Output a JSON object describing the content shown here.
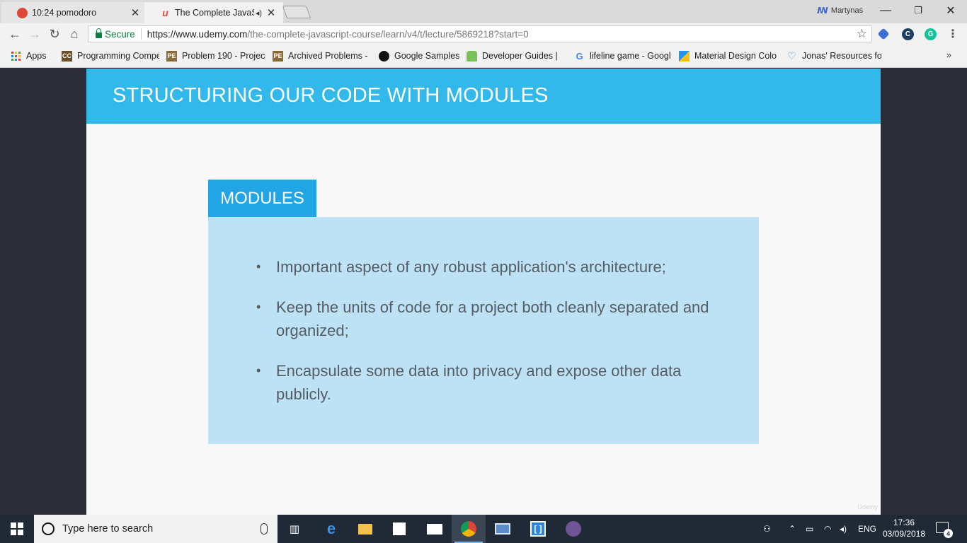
{
  "browser": {
    "tabs": [
      {
        "title": "10:24 pomodoro",
        "close": "✕"
      },
      {
        "title": "The Complete JavaScr",
        "audio": "◂)",
        "close": "✕"
      }
    ],
    "profile_name": "Martynas",
    "window_controls": {
      "minimize": "—",
      "maximize": "❐",
      "close": "✕"
    },
    "secure_label": "Secure",
    "url_host": "https://www.udemy.com",
    "url_path": "/the-complete-javascript-course/learn/v4/t/lecture/5869218?start=0",
    "bookmarks": [
      {
        "label": "Apps",
        "icon": "apps-grid"
      },
      {
        "label": "Programming Compe",
        "icon": "cc-icon",
        "icon_text": "CC",
        "color": "#6b4f2b"
      },
      {
        "label": "Problem 190 - Projec",
        "icon": "project-euler-icon",
        "icon_text": "PE",
        "color": "#8a6a3a"
      },
      {
        "label": "Archived Problems -",
        "icon": "project-euler-icon",
        "icon_text": "PE",
        "color": "#8a6a3a"
      },
      {
        "label": "Google Samples",
        "icon": "github-icon",
        "icon_text": "●",
        "color": "#111111"
      },
      {
        "label": "Developer Guides |",
        "icon": "android-icon",
        "icon_text": "▲",
        "color": "#78c257"
      },
      {
        "label": "lifeline game - Googl",
        "icon": "google-icon",
        "icon_text": "G",
        "color": "#4285f4"
      },
      {
        "label": "Material Design Colo",
        "icon": "material-icon",
        "icon_text": "",
        "color": "#2196f3"
      },
      {
        "label": "Jonas' Resources for",
        "icon": "heart-icon",
        "icon_text": "♡",
        "color": "#3a8fd8"
      }
    ],
    "overflow": "»"
  },
  "slide": {
    "title": "STRUCTURING OUR CODE WITH MODULES",
    "section_label": "MODULES",
    "bullets": [
      "Important aspect of any robust application's architecture;",
      "Keep the units of code for a project both cleanly separated and organized;",
      "Encapsulate some data into privacy and expose other data publicly."
    ],
    "watermark": "Udemy",
    "colors": {
      "header": "#33b8ec",
      "tab": "#22a5e4",
      "box": "#bde2f5",
      "text": "#555c63"
    }
  },
  "taskbar": {
    "search_placeholder": "Type here to search",
    "language": "ENG",
    "time": "17:36",
    "date": "03/09/2018",
    "notifications": "4"
  }
}
